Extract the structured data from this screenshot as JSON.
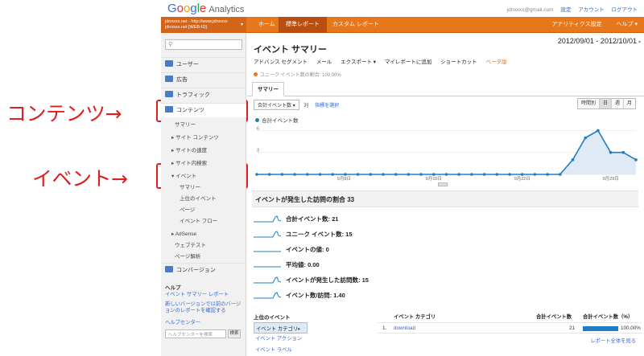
{
  "annotations": {
    "content": "コンテンツ→",
    "event": "イベント→"
  },
  "header": {
    "logo_google": [
      "G",
      "o",
      "o",
      "g",
      "l",
      "e"
    ],
    "logo_product": "Analytics",
    "email": "jdnxxxx@gmail.com",
    "links": [
      "設定",
      "アカウント",
      "ログアウト"
    ]
  },
  "nav": {
    "account_line1": "jdnxxxx.net - http://www.jdnxxxx",
    "account_line2": "jdnxxxx.net [WEB-ID] ",
    "tabs": [
      "ホーム",
      "標準レポート",
      "カスタム レポート"
    ],
    "active_tab": "標準レポート",
    "right": [
      "アナリティクス設定",
      "ヘルプ"
    ]
  },
  "sidebar": {
    "items": [
      {
        "label": "ユーザー"
      },
      {
        "label": "広告"
      },
      {
        "label": "トラフィック"
      },
      {
        "label": "コンテンツ"
      }
    ],
    "content_sub": [
      {
        "label": "サマリー",
        "arrow": ""
      },
      {
        "label": "サイト コンテンツ",
        "arrow": "▸"
      },
      {
        "label": "サイトの速度",
        "arrow": "▸"
      },
      {
        "label": "サイト内検索",
        "arrow": "▸"
      },
      {
        "label": "イベント",
        "arrow": "▾"
      }
    ],
    "event_sub": [
      "サマリー",
      "上位のイベント",
      "ページ",
      "イベント フロー"
    ],
    "content_sub2": [
      {
        "label": "AdSense",
        "arrow": "▸"
      },
      {
        "label": "ウェブテスト",
        "arrow": ""
      },
      {
        "label": "ページ解析",
        "arrow": ""
      }
    ],
    "conversion": "コンバージョン",
    "help_title": "ヘルプ",
    "help_link1": "イベント サマリー レポート",
    "help_link2": "新しいバージョンで以前のバージョンのレポートを確認する",
    "help_center": "ヘルプセンター",
    "help_search_placeholder": "ヘルプセンターを検索",
    "help_search_button": "検索"
  },
  "main": {
    "title": "イベント サマリー",
    "date_range": "2012/09/01 - 2012/10/01",
    "toolbar": [
      "アドバンス セグメント",
      "メール",
      "エクスポート ▾",
      "マイレポートに追加",
      "ショートカット"
    ],
    "beta": "ベータ版",
    "segment_note": "ユニーク イベント数の割合: 100.00%",
    "tab": "サマリー",
    "metric_select": "合計イベント数",
    "vs": "対",
    "compare_link": "指標を選択",
    "granularity": [
      "時間別",
      "日",
      "週",
      "月"
    ],
    "granularity_selected": "日",
    "legend": "合計イベント数",
    "section_title": "イベントが発生した訪問の割合 33",
    "metrics": [
      {
        "label": "合計イベント数: 21",
        "trend": "spike"
      },
      {
        "label": "ユニーク イベント数: 15",
        "trend": "spike"
      },
      {
        "label": "イベントの値: 0",
        "trend": "flat"
      },
      {
        "label": "平均値: 0.00",
        "trend": "flat"
      },
      {
        "label": "イベントが発生した訪問数: 15",
        "trend": "spike"
      },
      {
        "label": "イベント数/訪問: 1.40",
        "trend": "spike"
      }
    ],
    "bottom_left_header": "上位のイベント",
    "bottom_left_rows": [
      "イベント カテゴリ",
      "イベント アクション",
      "イベント ラベル"
    ],
    "bottom_right_headers": [
      "イベント カテゴリ",
      "合計イベント数",
      "合計イベント数（%）"
    ],
    "bottom_right_rows": [
      {
        "index": "1.",
        "category": "download",
        "count": "21",
        "percent": "100.00%"
      }
    ],
    "full_report": "レポート全体を見る"
  },
  "chart_data": {
    "type": "line",
    "series": [
      {
        "name": "合計イベント数",
        "values": [
          0,
          0,
          0,
          0,
          0,
          0,
          0,
          0,
          0,
          0,
          0,
          0,
          0,
          0,
          0,
          0,
          0,
          0,
          0,
          0,
          0,
          0,
          0,
          0,
          0,
          2,
          5,
          6,
          3,
          3,
          2
        ]
      }
    ],
    "y_ticks": [
      "6",
      "3"
    ],
    "x_tick_labels": [
      "9月8日",
      "9月15日",
      "9月22日",
      "9月29日"
    ],
    "ylim": [
      0,
      6.6
    ],
    "color": "#1e7ec1"
  }
}
